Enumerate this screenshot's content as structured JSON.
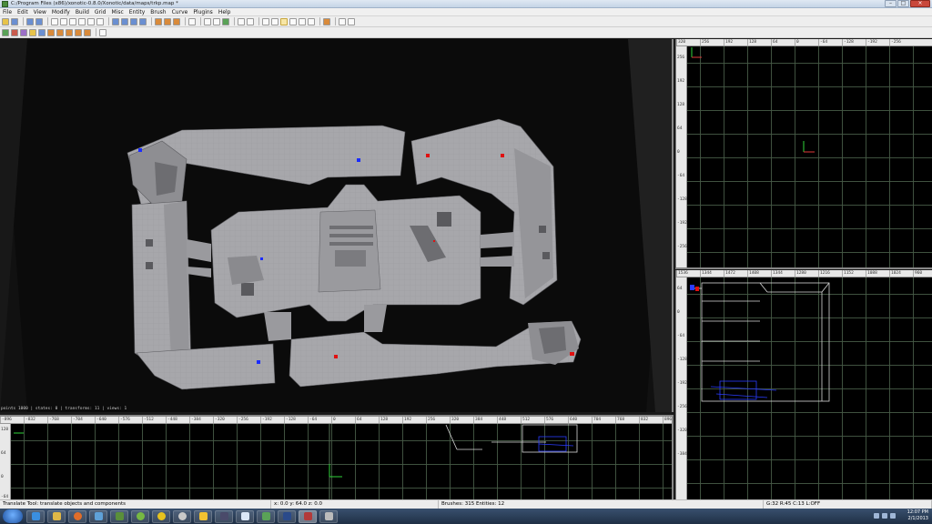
{
  "window": {
    "title": "C:/Program Files (x86)/xonotic-0.8.0/Xonotic/data/maps/trkp.map *",
    "controls": [
      "minimize",
      "maximize",
      "close"
    ]
  },
  "menu": [
    "File",
    "Edit",
    "View",
    "Modify",
    "Build",
    "Grid",
    "Misc",
    "Entity",
    "Brush",
    "Curve",
    "Plugins",
    "Help"
  ],
  "viewport3d": {
    "info": "points 1000 | states: 0 | transforms: 11 | views: 1"
  },
  "view_top": {
    "ruler_x": [
      "320",
      "256",
      "192",
      "128",
      "64",
      "0",
      "-64",
      "-128",
      "-192",
      "-256"
    ],
    "ruler_y": [
      "256",
      "192",
      "128",
      "64",
      "0",
      "-64",
      "-128",
      "-192",
      "-256"
    ]
  },
  "view_side": {
    "ruler_x": [
      "1536",
      "1344",
      "1472",
      "1408",
      "1344",
      "1280",
      "1216",
      "1152",
      "1088",
      "1024",
      "960"
    ],
    "ruler_y": [
      "64",
      "0",
      "-64",
      "-128",
      "-192",
      "-256",
      "-320",
      "-384"
    ]
  },
  "view_front": {
    "ruler_x": [
      "-896",
      "-832",
      "-768",
      "-704",
      "-640",
      "-576",
      "-512",
      "-448",
      "-384",
      "-320",
      "-256",
      "-192",
      "-128",
      "-64",
      "0",
      "64",
      "128",
      "192",
      "256",
      "320",
      "384",
      "448",
      "512",
      "576",
      "640",
      "704",
      "768",
      "832",
      "896"
    ],
    "ruler_y": [
      "128",
      "64",
      "0",
      "-64"
    ]
  },
  "status": {
    "hint": "Translate Tool: translate objects and components",
    "coords": "x:    0.0   y:    64.0   z:    0.0",
    "counts": "Brushes: 315 Entities: 12",
    "grid": "G:32  R:45  C:13  L:OFF"
  },
  "taskbar": {
    "time": "12:07 PM",
    "date": "2/1/2013"
  },
  "colors": {
    "floor": "#a7a7ab",
    "wall": "#8a8a8e",
    "void": "#0c0c0c",
    "spawn_blue": "#1a2cff",
    "spawn_red": "#e01010",
    "grid_line": "#465a46"
  }
}
